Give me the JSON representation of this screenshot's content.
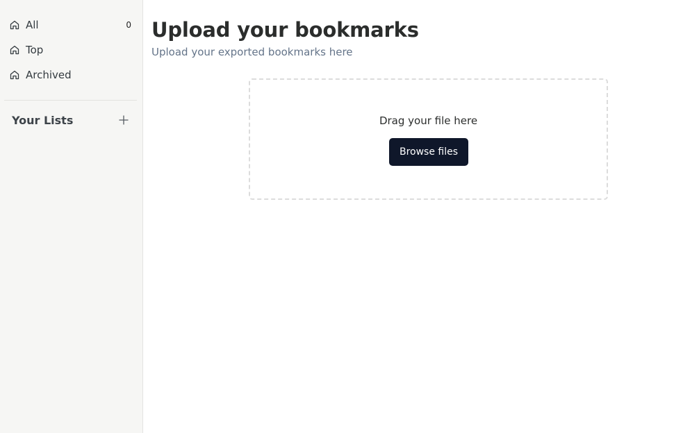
{
  "sidebar": {
    "items": [
      {
        "label": "All",
        "count": "0",
        "icon": "home-icon"
      },
      {
        "label": "Top",
        "icon": "home-icon"
      },
      {
        "label": "Archived",
        "icon": "home-icon"
      }
    ],
    "lists_title": "Your Lists",
    "add_list_icon": "plus-icon"
  },
  "main": {
    "title": "Upload your bookmarks",
    "subtitle": "Upload your exported bookmarks here",
    "dropzone": {
      "text": "Drag your file here",
      "button_label": "Browse files"
    }
  },
  "colors": {
    "sidebar_bg": "#f6f6f4",
    "subtitle": "#647489",
    "button_bg": "#0f172a",
    "button_text": "#ffffff",
    "dropzone_border": "#dcdcdc"
  }
}
